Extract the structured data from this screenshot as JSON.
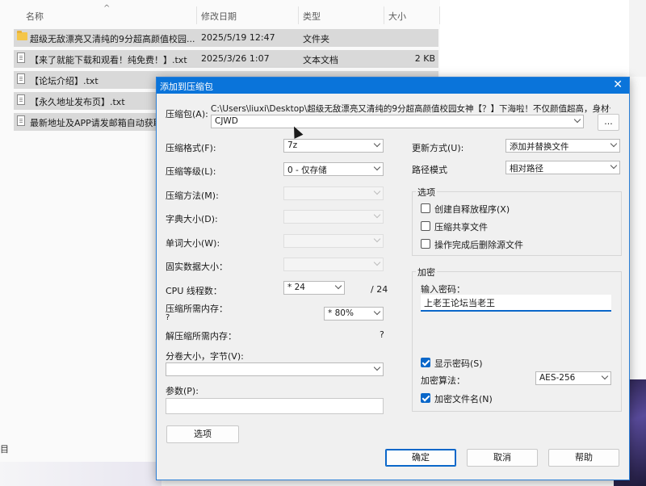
{
  "explorer": {
    "columns": {
      "name": "名称",
      "modified": "修改日期",
      "type": "类型",
      "size": "大小"
    },
    "files": [
      {
        "name": "超级无敌漂亮又清纯的9分超高颜值校园...",
        "modified": "2025/5/19 12:47",
        "type": "文件夹",
        "size": "",
        "icon": "folder-icon"
      },
      {
        "name": "【来了就能下载和观看！纯免费！】.txt",
        "modified": "2025/3/26 1:07",
        "type": "文本文档",
        "size": "2 KB",
        "icon": "text-file-icon"
      },
      {
        "name": "【论坛介绍】.txt",
        "modified": "",
        "type": "",
        "size": "",
        "icon": "text-file-icon"
      },
      {
        "name": "【永久地址发布页】.txt",
        "modified": "",
        "type": "",
        "size": "",
        "icon": "text-file-icon"
      },
      {
        "name": "最新地址及APP请发邮箱自动获取",
        "modified": "",
        "type": "",
        "size": "",
        "icon": "text-file-icon"
      }
    ],
    "left_cut_text": "目"
  },
  "dialog": {
    "title": "添加到压缩包",
    "archive_label": "压缩包(A):",
    "archive_path": "C:\\Users\\liuxi\\Desktop\\超级无敌漂亮又清纯的9分超高颜值校园女神【？】下海啦！不仅颜值超高，身材也无",
    "archive_name": "CJWD",
    "browse_label": "...",
    "format_label": "压缩格式(F):",
    "format_value": "7z",
    "level_label": "压缩等级(L):",
    "level_value": "0 - 仅存储",
    "method_label": "压缩方法(M):",
    "dict_label": "字典大小(D):",
    "word_label": "单词大小(W):",
    "solid_label": "固实数据大小：",
    "cpu_label": "CPU 线程数：",
    "cpu_value": "* 24",
    "cpu_max": "/ 24",
    "mem_comp_label": "压缩所需内存：",
    "mem_comp_q": "?",
    "mem_comp_value": "* 80%",
    "mem_decomp_label": "解压缩所需内存：",
    "mem_decomp_q": "?",
    "split_label": "分卷大小，字节(V):",
    "split_value": "",
    "params_label": "参数(P):",
    "params_value": "",
    "options_button": "选项",
    "update_label": "更新方式(U):",
    "update_value": "添加并替换文件",
    "path_label": "路径模式",
    "path_value": "相对路径",
    "options_group": "选项",
    "opt_sfx": "创建自释放程序(X)",
    "opt_shared": "压缩共享文件",
    "opt_delete": "操作完成后删除源文件",
    "encrypt_group": "加密",
    "password_label": "输入密码：",
    "password_value": "上老王论坛当老王",
    "show_password": "显示密码(S)",
    "enc_method_label": "加密算法：",
    "enc_method_value": "AES-256",
    "enc_names": "加密文件名(N)",
    "ok": "确定",
    "cancel": "取消",
    "help": "帮助",
    "close_glyph": "✕"
  },
  "colors": {
    "accent": "#0a74da",
    "checkbox": "#0a67c9",
    "selected_row": "#d9d9d9"
  }
}
